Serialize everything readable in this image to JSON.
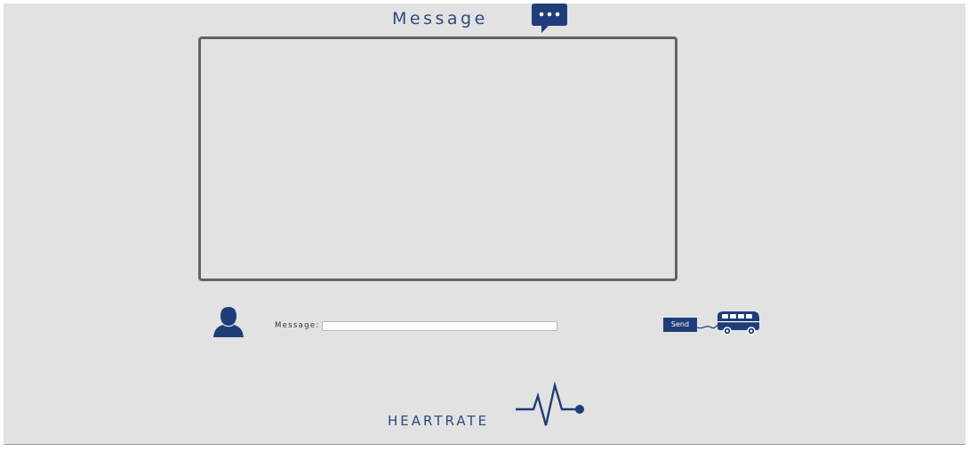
{
  "header": {
    "title": "Message",
    "icon": "chat-bubble-icon"
  },
  "message_area": {
    "content": ""
  },
  "compose": {
    "user_icon": "user-avatar-icon",
    "label": "Message:",
    "input_value": "",
    "input_placeholder": "",
    "send_label": "Send",
    "send_icon": "bus-icon"
  },
  "footer": {
    "label": "HEARTRATE",
    "icon": "heartbeat-pulse-icon"
  },
  "colors": {
    "accent": "#1f3d78",
    "title_text": "#2e4a7e",
    "background": "#e2e2e2",
    "box_border": "#636363"
  }
}
